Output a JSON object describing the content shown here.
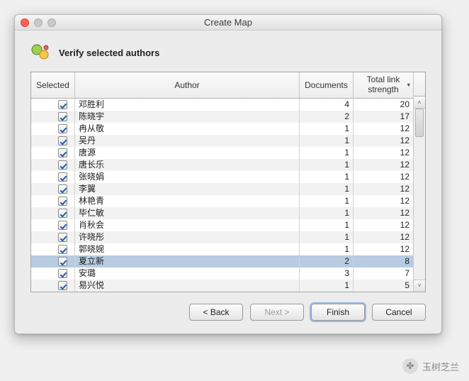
{
  "window": {
    "title": "Create Map"
  },
  "heading": {
    "text": "Verify selected authors"
  },
  "columns": {
    "selected": "Selected",
    "author": "Author",
    "documents": "Documents",
    "total_link_strength": "Total link\nstrength"
  },
  "sort_indicator": "▾",
  "rows": [
    {
      "selected": true,
      "author": "邓胜利",
      "documents": 4,
      "tls": 20,
      "highlight": false
    },
    {
      "selected": true,
      "author": "陈晓宇",
      "documents": 2,
      "tls": 17,
      "highlight": false
    },
    {
      "selected": true,
      "author": "冉从敬",
      "documents": 1,
      "tls": 12,
      "highlight": false
    },
    {
      "selected": true,
      "author": "吴丹",
      "documents": 1,
      "tls": 12,
      "highlight": false
    },
    {
      "selected": true,
      "author": "唐源",
      "documents": 1,
      "tls": 12,
      "highlight": false
    },
    {
      "selected": true,
      "author": "唐长乐",
      "documents": 1,
      "tls": 12,
      "highlight": false
    },
    {
      "selected": true,
      "author": "张晓娟",
      "documents": 1,
      "tls": 12,
      "highlight": false
    },
    {
      "selected": true,
      "author": "李翼",
      "documents": 1,
      "tls": 12,
      "highlight": false
    },
    {
      "selected": true,
      "author": "林艳青",
      "documents": 1,
      "tls": 12,
      "highlight": false
    },
    {
      "selected": true,
      "author": "毕仁敏",
      "documents": 1,
      "tls": 12,
      "highlight": false
    },
    {
      "selected": true,
      "author": "肖秋会",
      "documents": 1,
      "tls": 12,
      "highlight": false
    },
    {
      "selected": true,
      "author": "许晓彤",
      "documents": 1,
      "tls": 12,
      "highlight": false
    },
    {
      "selected": true,
      "author": "郭晓婉",
      "documents": 1,
      "tls": 12,
      "highlight": false
    },
    {
      "selected": true,
      "author": "夏立新",
      "documents": 2,
      "tls": 8,
      "highlight": true
    },
    {
      "selected": true,
      "author": "安璐",
      "documents": 3,
      "tls": 7,
      "highlight": false
    },
    {
      "selected": true,
      "author": "易兴悦",
      "documents": 1,
      "tls": 5,
      "highlight": false
    }
  ],
  "buttons": {
    "back": "< Back",
    "next": "Next >",
    "finish": "Finish",
    "cancel": "Cancel"
  },
  "scroll": {
    "up": "˄",
    "down": "˅"
  },
  "watermark": {
    "text": "玉树芝兰",
    "icon": "✤"
  }
}
